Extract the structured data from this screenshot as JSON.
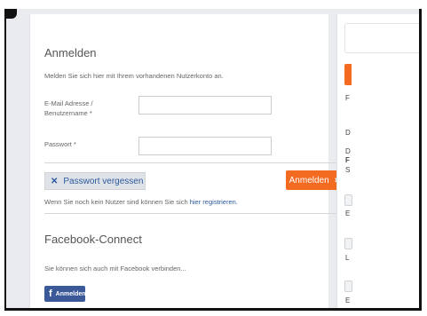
{
  "login": {
    "title": "Anmelden",
    "intro": "Melden Sie sich hier mit Ihrem vorhandenen Nutzerkonto an.",
    "email_label_line1": "E-Mail Adresse /",
    "email_label_line2": "Benutzername *",
    "email_value": "",
    "password_label": "Passwort *",
    "password_value": "",
    "forgot_label": "Passwort vergessen",
    "submit_label": "Anmelden",
    "register_text": "Wenn Sie noch kein Nutzer sind können Sie sich",
    "register_link": "hier registrieren."
  },
  "facebook": {
    "title": "Facebook-Connect",
    "text": "Sie können sich auch mit Facebook verbinden...",
    "button_label": "Anmelden"
  },
  "sidebar": {
    "letters": [
      "F",
      "D",
      "D",
      "F",
      "S",
      "E",
      "L",
      "E"
    ]
  },
  "colors": {
    "accent": "#f36b21",
    "link": "#2c5aa0",
    "facebook": "#3b5998"
  }
}
